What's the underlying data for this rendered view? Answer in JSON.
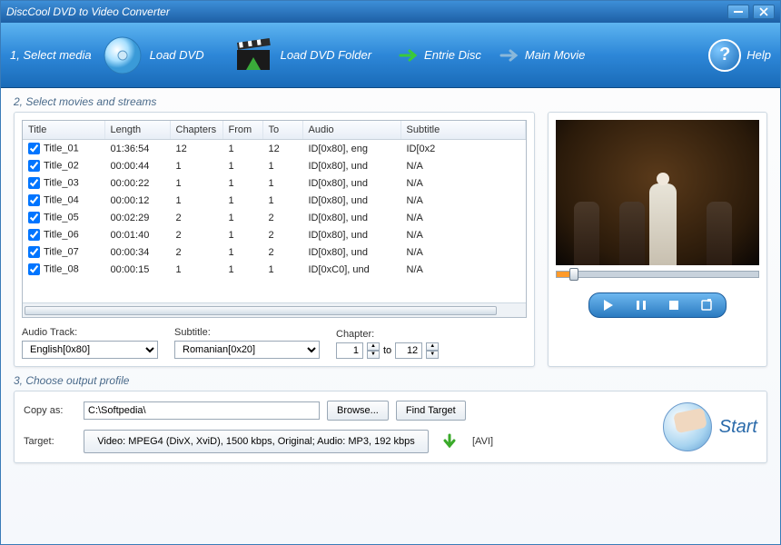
{
  "window": {
    "title": "DiscCool DVD to Video Converter"
  },
  "toolbar": {
    "step1": "1, Select media",
    "load_dvd": "Load DVD",
    "load_folder": "Load DVD Folder",
    "entire_disc": "Entrie Disc",
    "main_movie": "Main Movie",
    "help": "Help"
  },
  "section2": "2, Select movies and streams",
  "table": {
    "headers": {
      "title": "Title",
      "length": "Length",
      "chapters": "Chapters",
      "from": "From",
      "to": "To",
      "audio": "Audio",
      "subtitle": "Subtitle"
    },
    "rows": [
      {
        "title": "Title_01",
        "length": "01:36:54",
        "chapters": "12",
        "from": "1",
        "to": "12",
        "audio": "ID[0x80], eng",
        "subtitle": "ID[0x2"
      },
      {
        "title": "Title_02",
        "length": "00:00:44",
        "chapters": "1",
        "from": "1",
        "to": "1",
        "audio": "ID[0x80], und",
        "subtitle": "N/A"
      },
      {
        "title": "Title_03",
        "length": "00:00:22",
        "chapters": "1",
        "from": "1",
        "to": "1",
        "audio": "ID[0x80], und",
        "subtitle": "N/A"
      },
      {
        "title": "Title_04",
        "length": "00:00:12",
        "chapters": "1",
        "from": "1",
        "to": "1",
        "audio": "ID[0x80], und",
        "subtitle": "N/A"
      },
      {
        "title": "Title_05",
        "length": "00:02:29",
        "chapters": "2",
        "from": "1",
        "to": "2",
        "audio": "ID[0x80], und",
        "subtitle": "N/A"
      },
      {
        "title": "Title_06",
        "length": "00:01:40",
        "chapters": "2",
        "from": "1",
        "to": "2",
        "audio": "ID[0x80], und",
        "subtitle": "N/A"
      },
      {
        "title": "Title_07",
        "length": "00:00:34",
        "chapters": "2",
        "from": "1",
        "to": "2",
        "audio": "ID[0x80], und",
        "subtitle": "N/A"
      },
      {
        "title": "Title_08",
        "length": "00:00:15",
        "chapters": "1",
        "from": "1",
        "to": "1",
        "audio": "ID[0xC0], und",
        "subtitle": "N/A"
      }
    ]
  },
  "controls": {
    "audio_label": "Audio Track:",
    "audio_value": "English[0x80]",
    "subtitle_label": "Subtitle:",
    "subtitle_value": "Romanian[0x20]",
    "chapter_label": "Chapter:",
    "chapter_from": "1",
    "chapter_to_word": "to",
    "chapter_to": "12"
  },
  "section3": "3, Choose output profile",
  "output": {
    "copy_label": "Copy as:",
    "copy_path": "C:\\Softpedia\\",
    "browse": "Browse...",
    "find_target": "Find Target",
    "target_label": "Target:",
    "target_desc": "Video: MPEG4 (DivX, XviD), 1500 kbps, Original; Audio: MP3, 192 kbps",
    "target_fmt": "[AVI]",
    "start": "Start"
  }
}
